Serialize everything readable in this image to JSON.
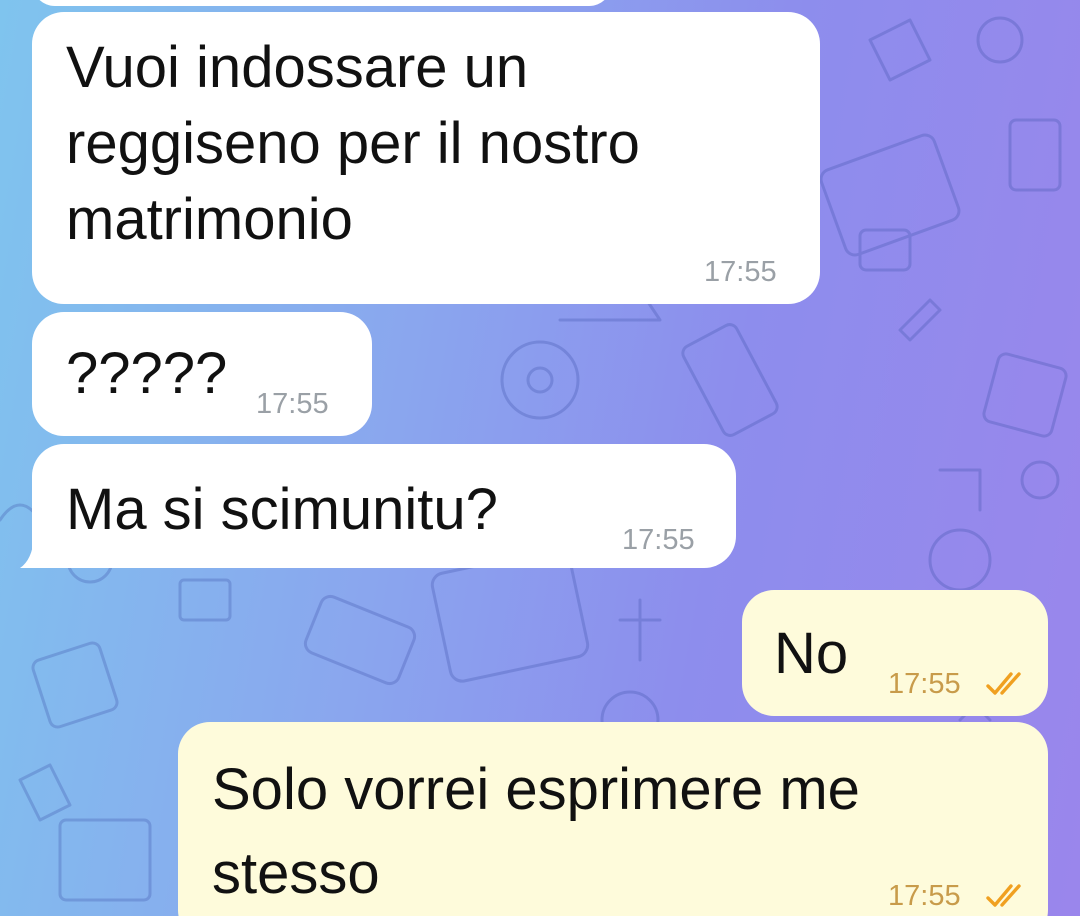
{
  "chat": {
    "background_colors": [
      "#7fc4ee",
      "#8d8ded",
      "#9a86ec"
    ],
    "incoming_bubble_color": "#ffffff",
    "outgoing_bubble_color": "#fefbdb",
    "read_tick_color": "#f0a020",
    "messages": [
      {
        "direction": "incoming",
        "lines": [
          "Vuoi indossare un",
          "reggiseno per il nostro",
          "matrimonio"
        ],
        "time": "17:55"
      },
      {
        "direction": "incoming",
        "lines": [
          "?????"
        ],
        "time": "17:55"
      },
      {
        "direction": "incoming",
        "lines": [
          "Ma si scimunitu?"
        ],
        "time": "17:55"
      },
      {
        "direction": "outgoing",
        "lines": [
          "No"
        ],
        "time": "17:55",
        "status_icon": "double-check-icon"
      },
      {
        "direction": "outgoing",
        "lines": [
          "Solo vorrei esprimere me",
          "stesso"
        ],
        "time": "17:55",
        "status_icon": "double-check-icon"
      }
    ]
  }
}
